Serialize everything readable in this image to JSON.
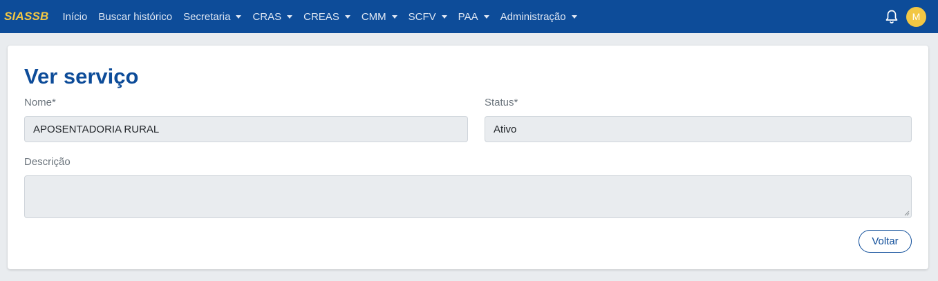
{
  "navbar": {
    "brand": "SIASSB",
    "items": [
      {
        "label": "Início",
        "dropdown": false
      },
      {
        "label": "Buscar histórico",
        "dropdown": false
      },
      {
        "label": "Secretaria",
        "dropdown": true
      },
      {
        "label": "CRAS",
        "dropdown": true
      },
      {
        "label": "CREAS",
        "dropdown": true
      },
      {
        "label": "CMM",
        "dropdown": true
      },
      {
        "label": "SCFV",
        "dropdown": true
      },
      {
        "label": "PAA",
        "dropdown": true
      },
      {
        "label": "Administração",
        "dropdown": true
      }
    ],
    "notification_icon": "bell-icon",
    "avatar_initial": "M"
  },
  "page": {
    "title": "Ver serviço"
  },
  "form": {
    "nome": {
      "label": "Nome*",
      "value": "APOSENTADORIA RURAL"
    },
    "status": {
      "label": "Status*",
      "value": "Ativo"
    },
    "descricao": {
      "label": "Descrição",
      "value": ""
    }
  },
  "actions": {
    "back_label": "Voltar"
  },
  "colors": {
    "primary": "#0d4c99",
    "brand_accent": "#f2c744",
    "background": "#e9ecef",
    "field_background": "#e9ecef",
    "label": "#6c757d"
  }
}
